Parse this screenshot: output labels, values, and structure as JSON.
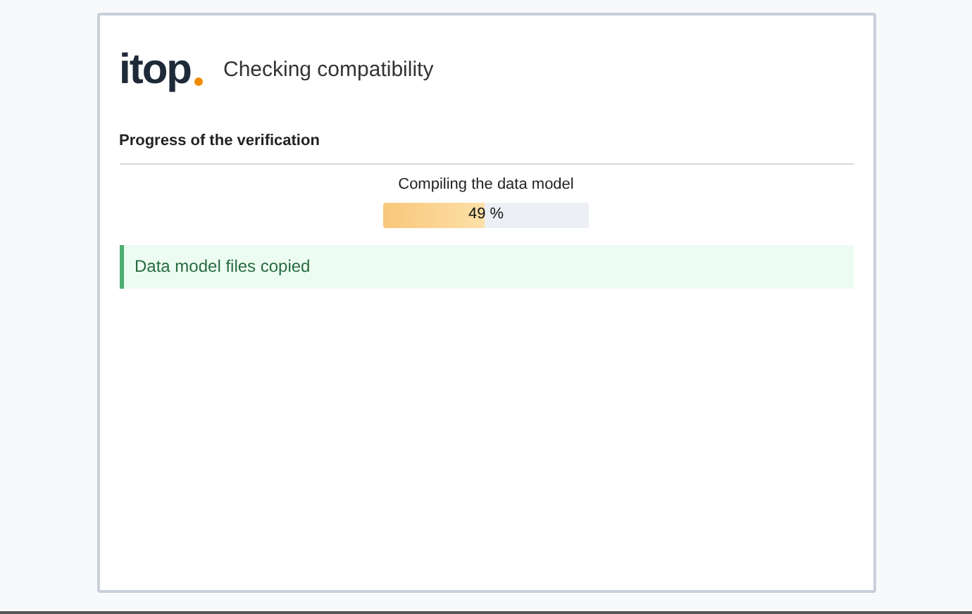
{
  "header": {
    "logo": "itop",
    "title": "Checking compatibility"
  },
  "section": {
    "title": "Progress of the verification"
  },
  "progress": {
    "label": "Compiling the data model",
    "level": 0.49,
    "reading": "49 %"
  },
  "messages": [
    {
      "kind": "success",
      "text": "Data model files copied"
    }
  ]
}
